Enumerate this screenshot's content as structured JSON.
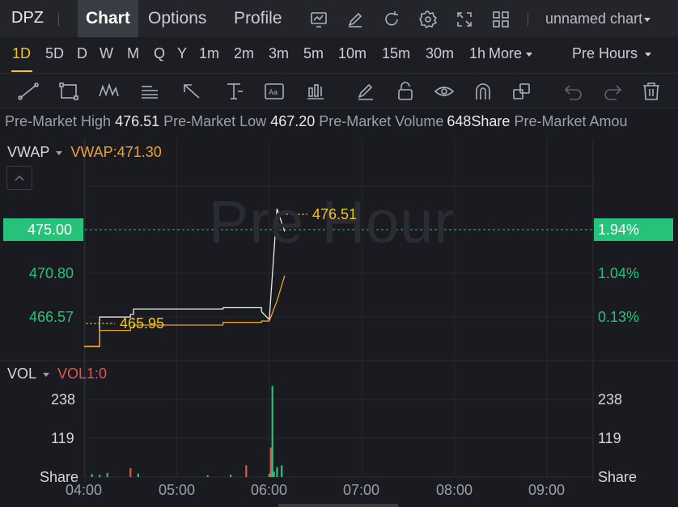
{
  "header": {
    "ticker": "DPZ",
    "tabs": [
      {
        "label": "Chart",
        "active": true
      },
      {
        "label": "Options",
        "active": false
      },
      {
        "label": "Profile",
        "active": false
      }
    ],
    "toolbar_icons": [
      "chart-icon",
      "edit-icon",
      "refresh-icon",
      "settings-icon",
      "fullscreen-icon",
      "layout-grid-icon"
    ],
    "chart_name": "unnamed chart"
  },
  "timeframes": {
    "items": [
      "1D",
      "5D",
      "D",
      "W",
      "M",
      "Q",
      "Y",
      "1m",
      "2m",
      "3m",
      "5m",
      "10m",
      "15m",
      "30m",
      "1h"
    ],
    "active": "1D",
    "more_label": "More",
    "session_label": "Pre Hours"
  },
  "drawing_tools": [
    "trend-line-icon",
    "rectangle-icon",
    "pattern-icon",
    "text-note-icon",
    "arrow-icon",
    "vertical-measure-icon",
    "text-label-icon",
    "indicator-icon",
    "brush-icon",
    "lock-icon",
    "visibility-icon",
    "magnet-icon",
    "layers-icon",
    "undo-icon",
    "redo-icon",
    "trash-icon"
  ],
  "info": {
    "items": [
      {
        "label": "Pre-Market High",
        "value": "476.51"
      },
      {
        "label": "Pre-Market Low",
        "value": "467.20"
      },
      {
        "label": "Pre-Market Volume",
        "value": "648Share"
      },
      {
        "label": "Pre-Market Amou",
        "value": ""
      }
    ]
  },
  "price_panel": {
    "indicator_name": "VWAP",
    "indicator_value": "VWAP:471.30",
    "watermark": "Pre Hour",
    "left_axis": [
      "475.00",
      "470.80",
      "466.57"
    ],
    "right_axis": [
      "1.94%",
      "1.04%",
      "0.13%"
    ],
    "high_annotation": "476.51",
    "low_annotation": "465.95"
  },
  "volume_panel": {
    "indicator_name": "VOL",
    "indicator_value": "VOL1:0",
    "axis": [
      "238",
      "119",
      "Share"
    ]
  },
  "time_axis": [
    "04:00",
    "05:00",
    "06:00",
    "07:00",
    "08:00",
    "09:00"
  ],
  "colors": {
    "up": "#27c27a",
    "down": "#e0574b",
    "vwap": "#f0a030",
    "price": "#e8e8e8",
    "accent": "#f5c518"
  },
  "chart_data": [
    {
      "type": "line",
      "x": [
        "04:00",
        "04:10",
        "04:30",
        "04:32",
        "05:30",
        "05:55",
        "06:00",
        "06:05",
        "06:10"
      ],
      "series": [
        {
          "name": "",
          "values": [
            466.0,
            468.2,
            468.4,
            468.8,
            468.9,
            468.6,
            468.0,
            476.3,
            474.6
          ]
        },
        {
          "name": "VWAP",
          "values": [
            466.0,
            467.2,
            467.4,
            467.6,
            467.8,
            467.9,
            467.9,
            469.4,
            471.3
          ]
        }
      ],
      "ylim": [
        465.0,
        478.0
      ]
    },
    {
      "type": "bar",
      "name": "VOL",
      "categories": [
        "04:05",
        "04:10",
        "04:15",
        "04:30",
        "04:35",
        "05:20",
        "05:35",
        "05:45",
        "06:00",
        "06:01",
        "06:02",
        "06:03",
        "06:05",
        "06:08"
      ],
      "values": [
        10,
        8,
        14,
        30,
        12,
        6,
        8,
        40,
        12,
        100,
        310,
        18,
        34,
        40
      ],
      "ylim": [
        0,
        330
      ]
    }
  ]
}
